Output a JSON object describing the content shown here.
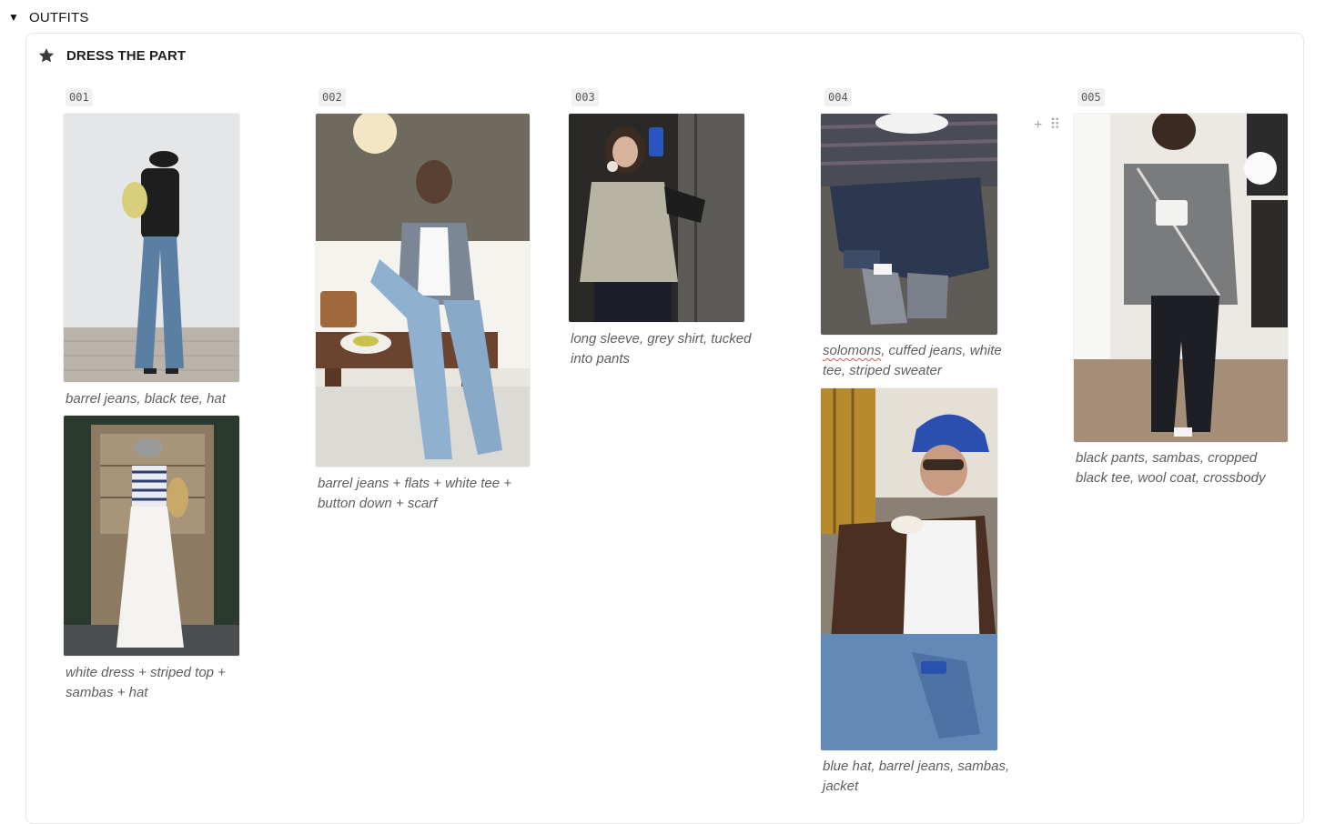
{
  "toggle": {
    "arrow": "▼",
    "title": "OUTFITS"
  },
  "callout": {
    "icon": "star-icon",
    "title": "DRESS THE PART"
  },
  "columns": [
    {
      "number": "001",
      "items": [
        {
          "caption": "barrel jeans, black tee, hat",
          "icon": "photo-outfit-001a"
        },
        {
          "caption": "white dress + striped top + sambas + hat",
          "icon": "photo-outfit-001b"
        }
      ]
    },
    {
      "number": "002",
      "items": [
        {
          "caption": "barrel jeans + flats + white tee + button down + scarf",
          "icon": "photo-outfit-002"
        }
      ]
    },
    {
      "number": "003",
      "items": [
        {
          "caption": "long sleeve, grey shirt, tucked into pants",
          "icon": "photo-outfit-003"
        }
      ]
    },
    {
      "number": "004",
      "items": [
        {
          "caption_flagged": "solomons",
          "caption_rest": ", cuffed jeans, white tee, striped sweater",
          "icon": "photo-outfit-004a"
        },
        {
          "caption": "blue hat, barrel jeans, sambas, jacket",
          "icon": "photo-outfit-004b"
        }
      ]
    },
    {
      "number": "005",
      "items": [
        {
          "caption": "black pants, sambas, cropped black tee, wool coat, crossbody",
          "icon": "photo-outfit-005"
        }
      ]
    }
  ],
  "block_handles": {
    "add": "+",
    "drag": "⠿"
  },
  "colors": {
    "spellcheck": "#d9534f",
    "caption": "#5f5e5b",
    "badge_bg": "#f1f1ef"
  }
}
